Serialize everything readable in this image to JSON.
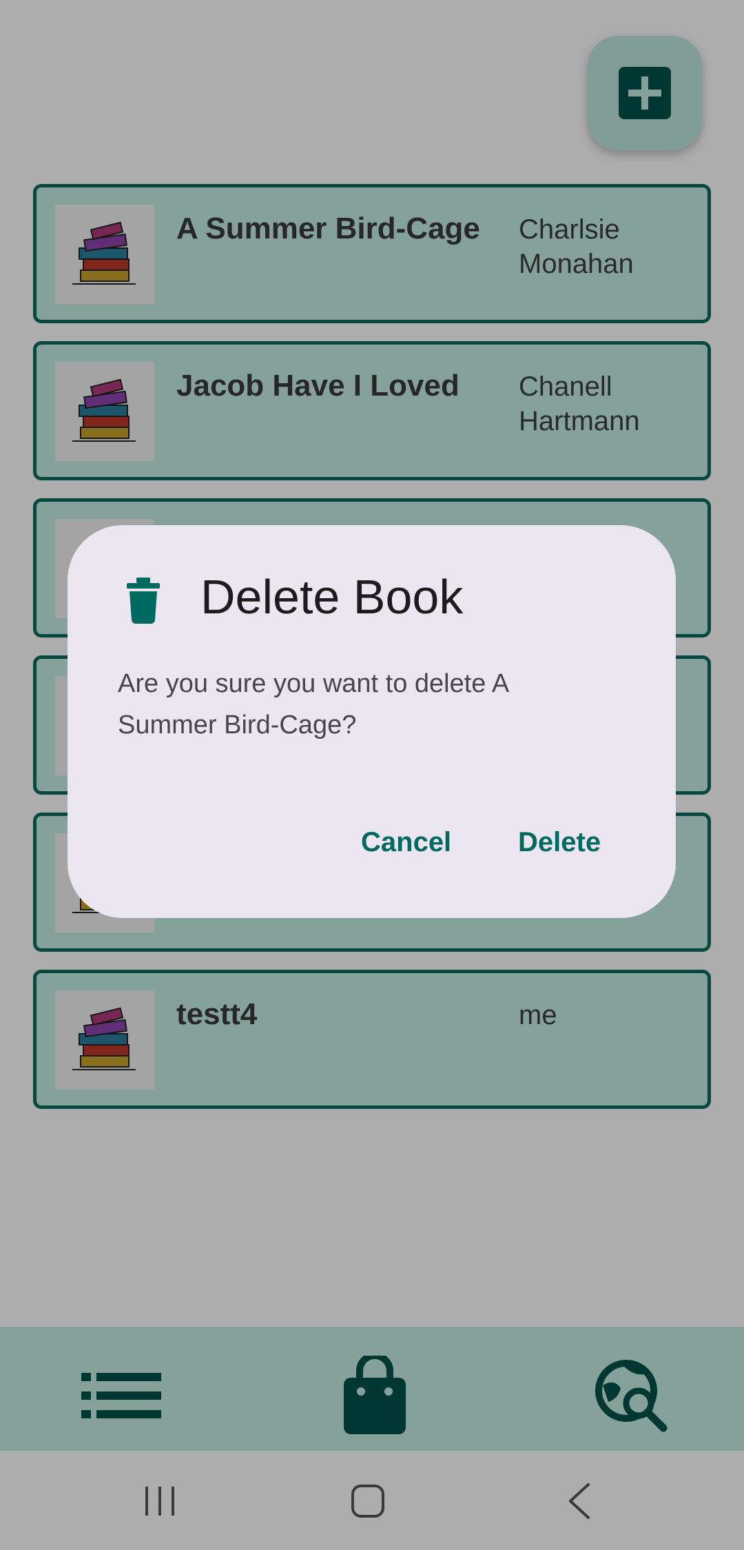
{
  "add_button": {
    "icon": "plus-icon"
  },
  "books": [
    {
      "title": "A Summer Bird-Cage",
      "author_line1": "Charlsie",
      "author_line2": "Monahan"
    },
    {
      "title": "Jacob Have I Loved",
      "author_line1": "Chanell",
      "author_line2": "Hartmann"
    },
    {
      "title": "",
      "author_line1": "",
      "author_line2": ""
    },
    {
      "title": "",
      "author_line1": "",
      "author_line2": ""
    },
    {
      "title": "",
      "author_line1": "",
      "author_line2": ""
    },
    {
      "title": "testt4",
      "author_line1": "me",
      "author_line2": ""
    }
  ],
  "dialog": {
    "icon": "trash-icon",
    "title": "Delete Book",
    "message": "Are you sure you want to delete A Summer Bird-Cage?",
    "cancel_label": "Cancel",
    "delete_label": "Delete"
  },
  "bottom_nav": {
    "items": [
      {
        "icon": "list-icon"
      },
      {
        "icon": "shopping-bag-icon"
      },
      {
        "icon": "travel-explore-icon"
      }
    ]
  },
  "system_nav": {
    "items": [
      {
        "icon": "recents-icon"
      },
      {
        "icon": "home-icon"
      },
      {
        "icon": "back-icon"
      }
    ]
  },
  "colors": {
    "primary": "#006a60",
    "card_bg": "#c3ede4",
    "card_border": "#0b6b5e",
    "dialog_bg": "#ece6f0"
  }
}
